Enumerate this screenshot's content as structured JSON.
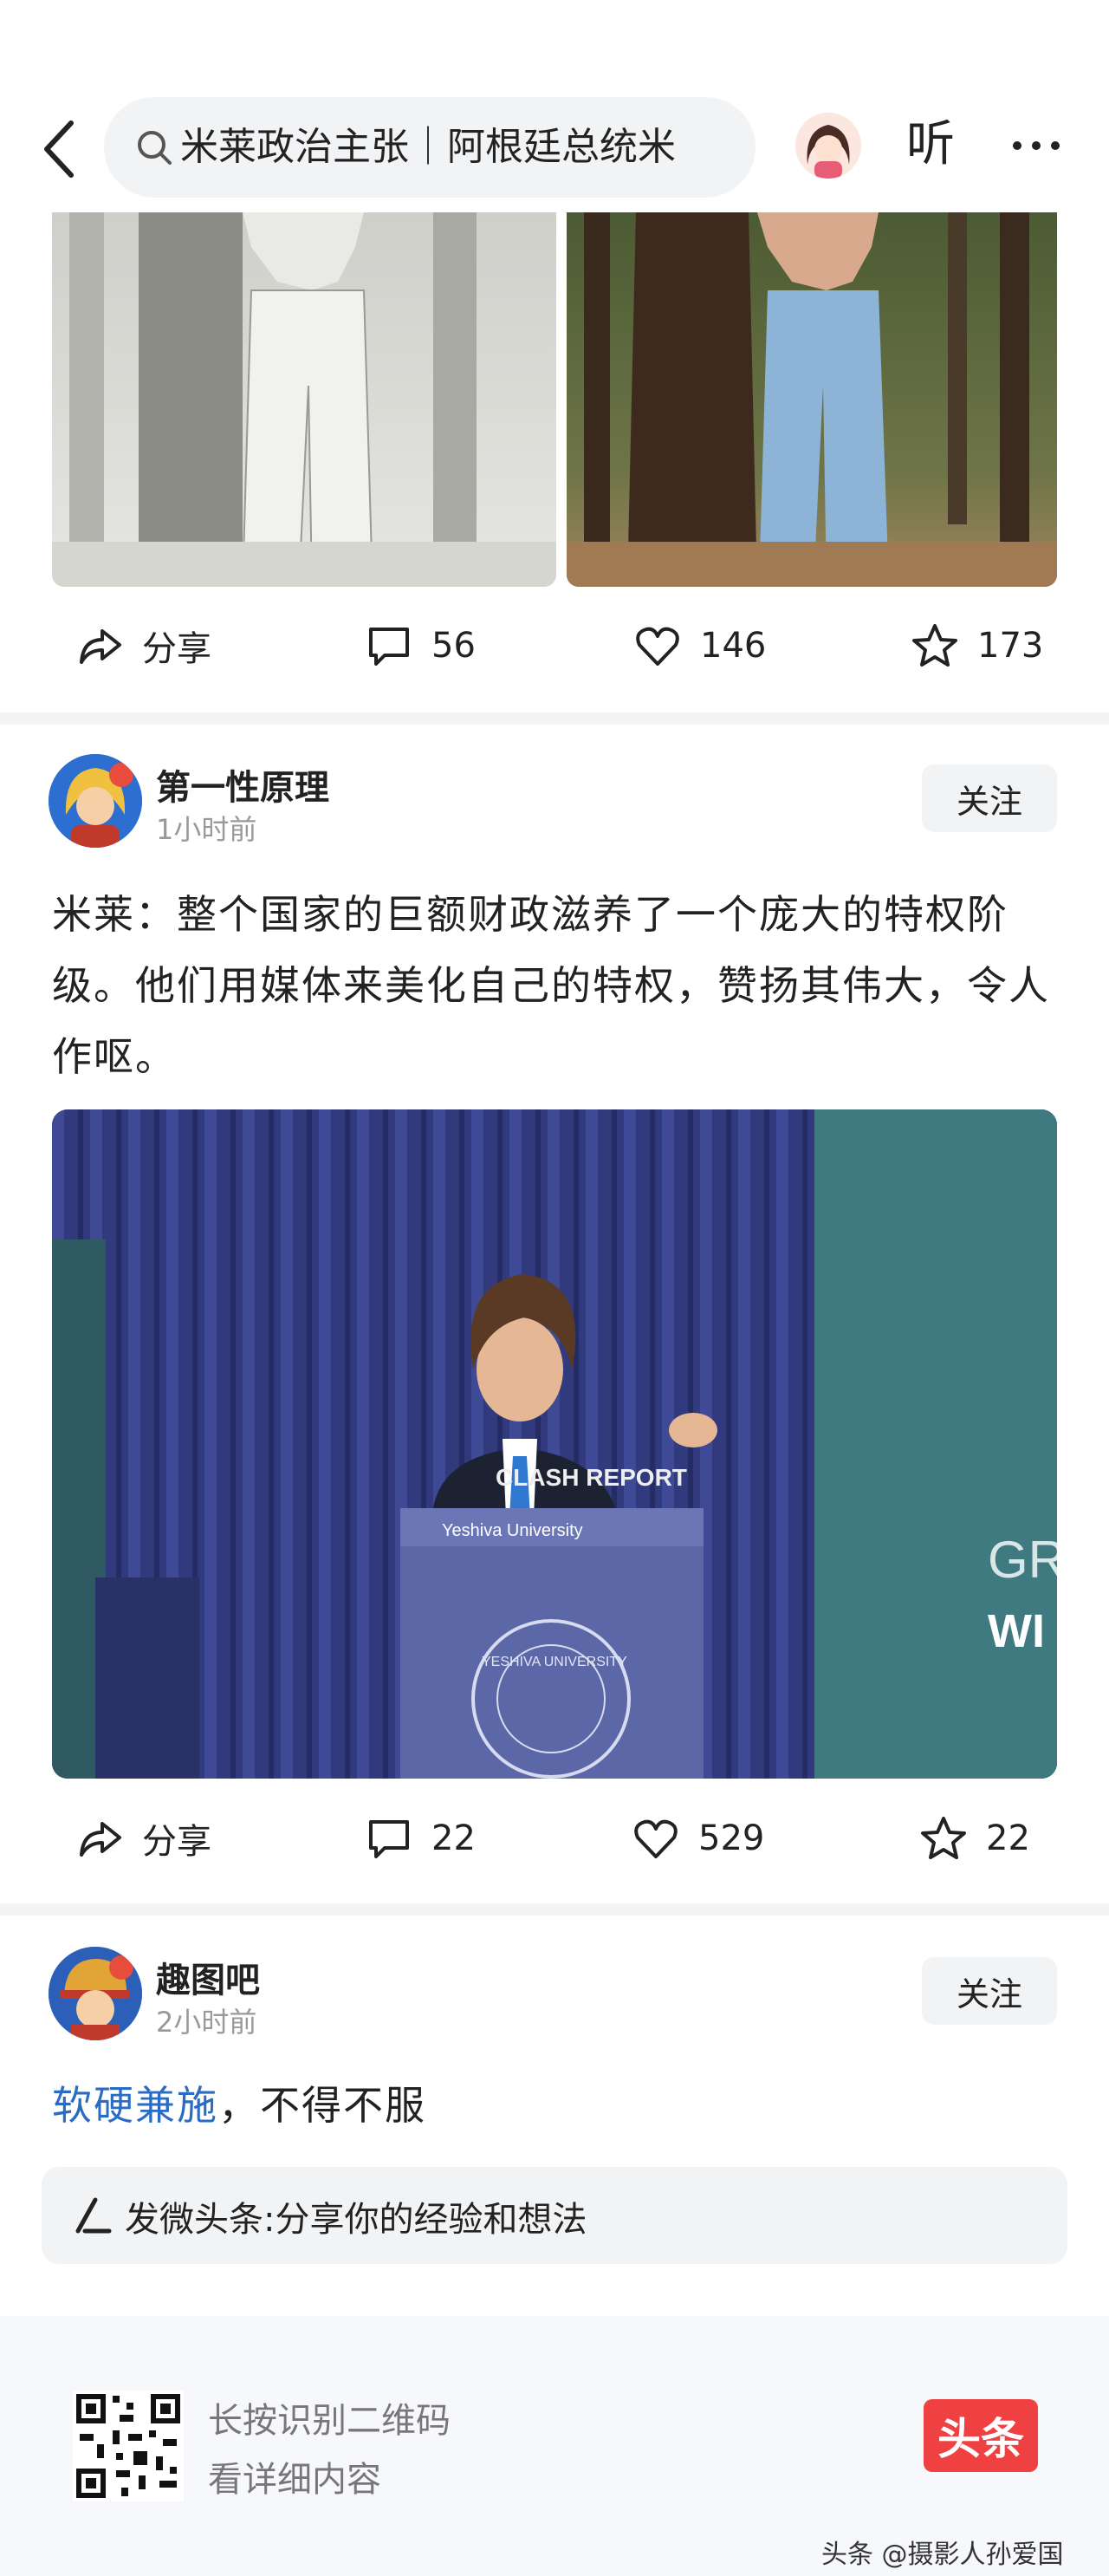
{
  "header": {
    "search_text": "米莱政治主张｜阿根廷总统米",
    "listen_label": "听"
  },
  "post1": {
    "actions": {
      "share_label": "分享",
      "comments": "56",
      "likes": "146",
      "favorites": "173"
    }
  },
  "post2": {
    "author": "第一性原理",
    "time": "1小时前",
    "follow_label": "关注",
    "text": "米莱：整个国家的巨额财政滋养了一个庞大的特权阶级。他们用媒体来美化自己的特权，赞扬其伟大，令人作呕。",
    "video": {
      "overlay_logo": "CLASH REPORT",
      "podium_text": "Yeshiva University",
      "seal_text": "YESHIVA UNIVERSITY",
      "wall_text_1": "GR",
      "wall_text_2": "WI"
    },
    "actions": {
      "share_label": "分享",
      "comments": "22",
      "likes": "529",
      "favorites": "22"
    }
  },
  "post3": {
    "author": "趣图吧",
    "time": "2小时前",
    "follow_label": "关注",
    "text_highlight": "软硬兼施",
    "text_rest": "，不得不服"
  },
  "composer": {
    "placeholder": "发微头条:分享你的经验和想法"
  },
  "footer": {
    "qr_line1": "长按识别二维码",
    "qr_line2": "看详细内容",
    "brand": "头条",
    "watermark": "头条 @摄影人孙爱国"
  },
  "colors": {
    "accent_link": "#2a6cc4",
    "brand_red": "#f04142",
    "divider": "#f3f4f6"
  }
}
